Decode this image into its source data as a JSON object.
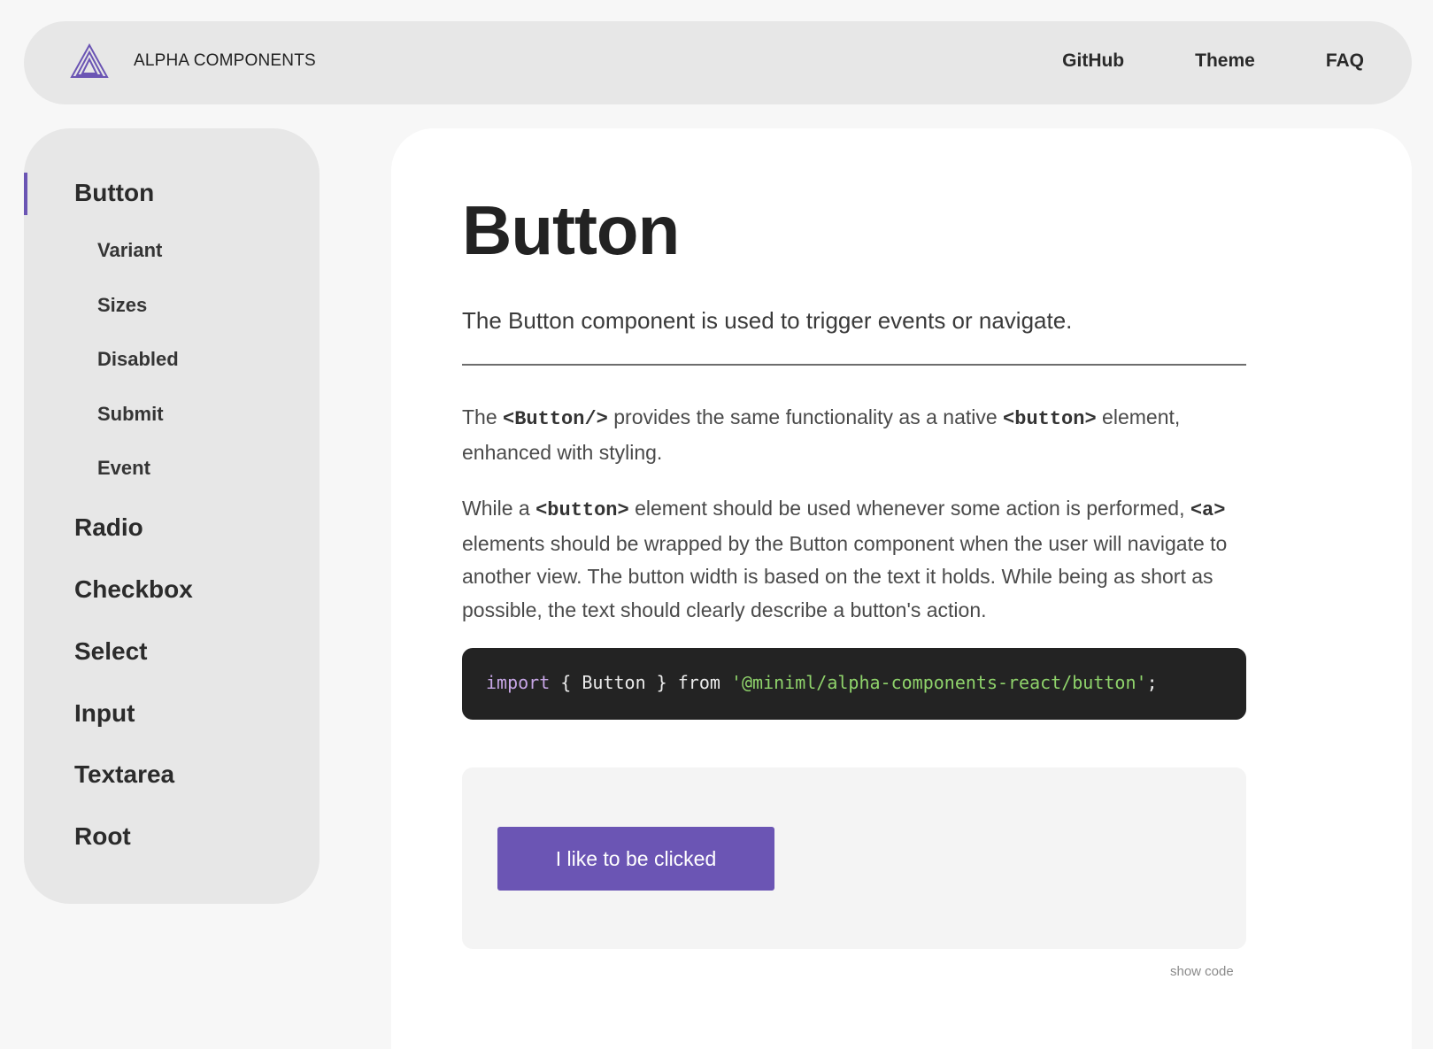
{
  "header": {
    "brand": "ALPHA COMPONENTS",
    "nav": [
      "GitHub",
      "Theme",
      "FAQ"
    ]
  },
  "sidebar": {
    "items": [
      {
        "label": "Button",
        "level": "top",
        "active": true
      },
      {
        "label": "Variant",
        "level": "sub"
      },
      {
        "label": "Sizes",
        "level": "sub"
      },
      {
        "label": "Disabled",
        "level": "sub"
      },
      {
        "label": "Submit",
        "level": "sub"
      },
      {
        "label": "Event",
        "level": "sub"
      },
      {
        "label": "Radio",
        "level": "top"
      },
      {
        "label": "Checkbox",
        "level": "top"
      },
      {
        "label": "Select",
        "level": "top"
      },
      {
        "label": "Input",
        "level": "top"
      },
      {
        "label": "Textarea",
        "level": "top"
      },
      {
        "label": "Root",
        "level": "top"
      }
    ]
  },
  "main": {
    "title": "Button",
    "lead": "The Button component is used to trigger events or navigate.",
    "p1": {
      "t1": "The ",
      "c1": "<Button/>",
      "t2": " provides the same functionality as a native ",
      "c2": "<button>",
      "t3": " element, enhanced with styling."
    },
    "p2": {
      "t1": "While a ",
      "c1": "<button>",
      "t2": " element should be used whenever some action is performed, ",
      "c2": "<a>",
      "t3": " elements should be wrapped by the Button component when the user will navigate to another view. The button width is based on the text it holds. While being as short as possible, the text should clearly describe a button's action."
    },
    "code": {
      "keyword": "import",
      "middle": " { Button } from ",
      "string": "'@miniml/alpha-components-react/button'",
      "end": ";"
    },
    "demo_button": "I like to be clicked",
    "show_code": "show code"
  },
  "colors": {
    "accent": "#6b55b4",
    "code_bg": "#232323",
    "keyword": "#c7a6e6",
    "string": "#8fd36b"
  }
}
